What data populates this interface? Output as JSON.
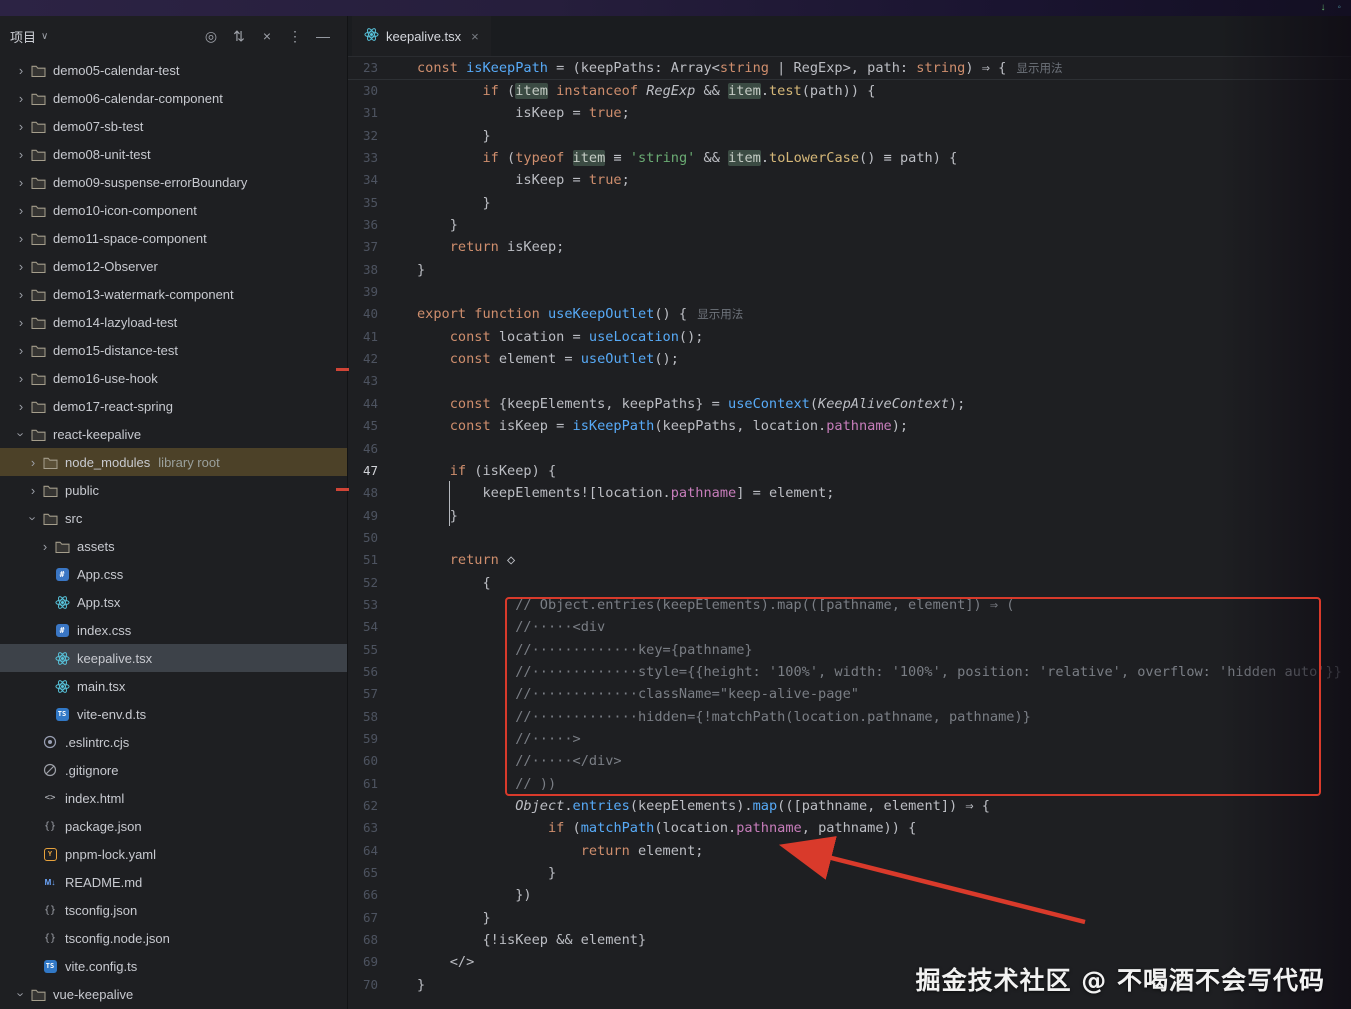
{
  "titlebar": {
    "right_icons": [
      "update-arrow-icon",
      "status-dot-icon"
    ]
  },
  "sidebar": {
    "toolbar": {
      "title": "项目",
      "caret": "∨",
      "icons": [
        "locate",
        "expand-all",
        "collapse-all",
        "more-options",
        "hide-panel"
      ]
    },
    "tree": [
      {
        "label": "demo05-calendar-test",
        "level": 0,
        "icon": "folder",
        "chev": "r"
      },
      {
        "label": "demo06-calendar-component",
        "level": 0,
        "icon": "folder",
        "chev": "r"
      },
      {
        "label": "demo07-sb-test",
        "level": 0,
        "icon": "folder",
        "chev": "r"
      },
      {
        "label": "demo08-unit-test",
        "level": 0,
        "icon": "folder",
        "chev": "r"
      },
      {
        "label": "demo09-suspense-errorBoundary",
        "level": 0,
        "icon": "folder",
        "chev": "r"
      },
      {
        "label": "demo10-icon-component",
        "level": 0,
        "icon": "folder",
        "chev": "r"
      },
      {
        "label": "demo11-space-component",
        "level": 0,
        "icon": "folder",
        "chev": "r"
      },
      {
        "label": "demo12-Observer",
        "level": 0,
        "icon": "folder",
        "chev": "r"
      },
      {
        "label": "demo13-watermark-component",
        "level": 0,
        "icon": "folder",
        "chev": "r"
      },
      {
        "label": "demo14-lazyload-test",
        "level": 0,
        "icon": "folder",
        "chev": "r"
      },
      {
        "label": "demo15-distance-test",
        "level": 0,
        "icon": "folder",
        "chev": "r"
      },
      {
        "label": "demo16-use-hook",
        "level": 0,
        "icon": "folder",
        "chev": "r"
      },
      {
        "label": "demo17-react-spring",
        "level": 0,
        "icon": "folder",
        "chev": "r"
      },
      {
        "label": "react-keepalive",
        "level": 0,
        "icon": "folder",
        "chev": "d"
      },
      {
        "label": "node_modules",
        "level": 1,
        "icon": "folder",
        "chev": "r",
        "badge": "library root",
        "hl": "lib"
      },
      {
        "label": "public",
        "level": 1,
        "icon": "folder",
        "chev": "r"
      },
      {
        "label": "src",
        "level": 1,
        "icon": "folder",
        "chev": "d"
      },
      {
        "label": "assets",
        "level": 2,
        "icon": "folder",
        "chev": "r"
      },
      {
        "label": "App.css",
        "level": 2,
        "icon": "css"
      },
      {
        "label": "App.tsx",
        "level": 2,
        "icon": "react"
      },
      {
        "label": "index.css",
        "level": 2,
        "icon": "css"
      },
      {
        "label": "keepalive.tsx",
        "level": 2,
        "icon": "react",
        "hl": "sel"
      },
      {
        "label": "main.tsx",
        "level": 2,
        "icon": "react"
      },
      {
        "label": "vite-env.d.ts",
        "level": 2,
        "icon": "ts"
      },
      {
        "label": ".eslintrc.cjs",
        "level": 1,
        "icon": "eslint"
      },
      {
        "label": ".gitignore",
        "level": 1,
        "icon": "ignore"
      },
      {
        "label": "index.html",
        "level": 1,
        "icon": "html"
      },
      {
        "label": "package.json",
        "level": 1,
        "icon": "json"
      },
      {
        "label": "pnpm-lock.yaml",
        "level": 1,
        "icon": "pnpm"
      },
      {
        "label": "README.md",
        "level": 1,
        "icon": "md"
      },
      {
        "label": "tsconfig.json",
        "level": 1,
        "icon": "json"
      },
      {
        "label": "tsconfig.node.json",
        "level": 1,
        "icon": "json"
      },
      {
        "label": "vite.config.ts",
        "level": 1,
        "icon": "ts"
      },
      {
        "label": "vue-keepalive",
        "level": 0,
        "icon": "folder",
        "chev": "d"
      }
    ]
  },
  "editor": {
    "tab": {
      "label": "keepalive.tsx",
      "close": "×"
    },
    "sticky": {
      "n": "23",
      "s": [
        [
          "const ",
          "k"
        ],
        [
          "isKeepPath",
          "f"
        ],
        [
          " = (keepPaths: Array<",
          "d"
        ],
        [
          "string",
          "k"
        ],
        [
          " | RegExp>, path: ",
          "d"
        ],
        [
          "string",
          "k"
        ],
        [
          ") ⇒ { ",
          "d"
        ],
        [
          "显示用法",
          "h"
        ]
      ]
    },
    "lines": [
      {
        "n": "30",
        "s": [
          [
            "        ",
            "d"
          ],
          [
            "if",
            "k"
          ],
          [
            " (",
            "d"
          ],
          [
            "item",
            "w"
          ],
          [
            " ",
            "d"
          ],
          [
            "instanceof",
            "k"
          ],
          [
            " ",
            "d"
          ],
          [
            "RegExp",
            "i"
          ],
          [
            " && ",
            "d"
          ],
          [
            "item",
            "w"
          ],
          [
            ".",
            "d"
          ],
          [
            "test",
            "m"
          ],
          [
            "(path)) {",
            "d"
          ]
        ]
      },
      {
        "n": "31",
        "s": [
          [
            "            isKeep = ",
            "d"
          ],
          [
            "true",
            "k"
          ],
          [
            ";",
            "d"
          ]
        ]
      },
      {
        "n": "32",
        "s": [
          [
            "        }",
            "d"
          ]
        ]
      },
      {
        "n": "33",
        "s": [
          [
            "        ",
            "d"
          ],
          [
            "if",
            "k"
          ],
          [
            " (",
            "d"
          ],
          [
            "typeof",
            "k"
          ],
          [
            " ",
            "d"
          ],
          [
            "item",
            "w"
          ],
          [
            " ≡ ",
            "d"
          ],
          [
            "'string'",
            "s"
          ],
          [
            " && ",
            "d"
          ],
          [
            "item",
            "w"
          ],
          [
            ".",
            "d"
          ],
          [
            "toLowerCase",
            "m"
          ],
          [
            "() ≡ path) {",
            "d"
          ]
        ]
      },
      {
        "n": "34",
        "s": [
          [
            "            isKeep = ",
            "d"
          ],
          [
            "true",
            "k"
          ],
          [
            ";",
            "d"
          ]
        ]
      },
      {
        "n": "35",
        "s": [
          [
            "        }",
            "d"
          ]
        ]
      },
      {
        "n": "36",
        "s": [
          [
            "    }",
            "d"
          ]
        ]
      },
      {
        "n": "37",
        "s": [
          [
            "    ",
            "d"
          ],
          [
            "return",
            "k"
          ],
          [
            " isKeep;",
            "d"
          ]
        ]
      },
      {
        "n": "38",
        "s": [
          [
            "}",
            "d"
          ]
        ]
      },
      {
        "n": "39",
        "s": []
      },
      {
        "n": "40",
        "s": [
          [
            "export",
            "k"
          ],
          [
            " ",
            "d"
          ],
          [
            "function",
            "k"
          ],
          [
            " ",
            "d"
          ],
          [
            "useKeepOutlet",
            "f"
          ],
          [
            "() { ",
            "d"
          ],
          [
            "显示用法",
            "h"
          ]
        ]
      },
      {
        "n": "41",
        "s": [
          [
            "    ",
            "d"
          ],
          [
            "const",
            "k"
          ],
          [
            " location = ",
            "d"
          ],
          [
            "useLocation",
            "f"
          ],
          [
            "();",
            "d"
          ]
        ]
      },
      {
        "n": "42",
        "s": [
          [
            "    ",
            "d"
          ],
          [
            "const",
            "k"
          ],
          [
            " element = ",
            "d"
          ],
          [
            "useOutlet",
            "f"
          ],
          [
            "();",
            "d"
          ]
        ]
      },
      {
        "n": "43",
        "s": []
      },
      {
        "n": "44",
        "s": [
          [
            "    ",
            "d"
          ],
          [
            "const",
            "k"
          ],
          [
            " {keepElements, keepPaths} = ",
            "d"
          ],
          [
            "useContext",
            "f"
          ],
          [
            "(",
            "d"
          ],
          [
            "KeepAliveContext",
            "i"
          ],
          [
            ");",
            "d"
          ]
        ]
      },
      {
        "n": "45",
        "s": [
          [
            "    ",
            "d"
          ],
          [
            "const",
            "k"
          ],
          [
            " isKeep = ",
            "d"
          ],
          [
            "isKeepPath",
            "f"
          ],
          [
            "(keepPaths, location.",
            "d"
          ],
          [
            "pathname",
            "p"
          ],
          [
            ");",
            "d"
          ]
        ]
      },
      {
        "n": "46",
        "s": []
      },
      {
        "n": "47",
        "cur": true,
        "s": [
          [
            "    ",
            "d"
          ],
          [
            "if",
            "k"
          ],
          [
            " (isKeep) {",
            "d"
          ]
        ]
      },
      {
        "n": "48",
        "s": [
          [
            "        keepElements![location.",
            "d"
          ],
          [
            "pathname",
            "p"
          ],
          [
            "] = element;",
            "d"
          ]
        ]
      },
      {
        "n": "49",
        "s": [
          [
            "    }",
            "d"
          ]
        ]
      },
      {
        "n": "50",
        "s": []
      },
      {
        "n": "51",
        "s": [
          [
            "    ",
            "d"
          ],
          [
            "return",
            "k"
          ],
          [
            " ◇",
            "d"
          ]
        ]
      },
      {
        "n": "52",
        "s": [
          [
            "        {",
            "d"
          ]
        ]
      },
      {
        "n": "53",
        "s": [
          [
            "            ",
            "d"
          ],
          [
            "// Object.entries(keepElements).map(([pathname, element]) ⇒ (",
            "c"
          ]
        ]
      },
      {
        "n": "54",
        "s": [
          [
            "            ",
            "d"
          ],
          [
            "//·····<div",
            "c"
          ]
        ]
      },
      {
        "n": "55",
        "s": [
          [
            "            ",
            "d"
          ],
          [
            "//·············key={pathname}",
            "c"
          ]
        ]
      },
      {
        "n": "56",
        "s": [
          [
            "            ",
            "d"
          ],
          [
            "//·············style={{height: '100%', width: '100%', position: 'relative', overflow: 'hidden auto'}}",
            "c"
          ]
        ]
      },
      {
        "n": "57",
        "s": [
          [
            "            ",
            "d"
          ],
          [
            "//·············className=\"keep-alive-page\"",
            "c"
          ]
        ]
      },
      {
        "n": "58",
        "s": [
          [
            "            ",
            "d"
          ],
          [
            "//·············hidden={!matchPath(location.pathname, pathname)}",
            "c"
          ]
        ]
      },
      {
        "n": "59",
        "s": [
          [
            "            ",
            "d"
          ],
          [
            "//·····>",
            "c"
          ]
        ]
      },
      {
        "n": "60",
        "s": [
          [
            "            ",
            "d"
          ],
          [
            "//·····</div>",
            "c"
          ]
        ]
      },
      {
        "n": "61",
        "s": [
          [
            "            ",
            "d"
          ],
          [
            "// ))",
            "c"
          ]
        ]
      },
      {
        "n": "62",
        "s": [
          [
            "            ",
            "d"
          ],
          [
            "Object",
            "i"
          ],
          [
            ".",
            "d"
          ],
          [
            "entries",
            "f"
          ],
          [
            "(keepElements).",
            "d"
          ],
          [
            "map",
            "f"
          ],
          [
            "(([pathname, element]) ⇒ {",
            "d"
          ]
        ]
      },
      {
        "n": "63",
        "s": [
          [
            "                ",
            "d"
          ],
          [
            "if",
            "k"
          ],
          [
            " (",
            "d"
          ],
          [
            "matchPath",
            "f"
          ],
          [
            "(location.",
            "d"
          ],
          [
            "pathname",
            "p"
          ],
          [
            ", pathname)) {",
            "d"
          ]
        ]
      },
      {
        "n": "64",
        "s": [
          [
            "                    ",
            "d"
          ],
          [
            "return",
            "k"
          ],
          [
            " element;",
            "d"
          ]
        ]
      },
      {
        "n": "65",
        "s": [
          [
            "                }",
            "d"
          ]
        ]
      },
      {
        "n": "66",
        "s": [
          [
            "            })",
            "d"
          ]
        ]
      },
      {
        "n": "67",
        "s": [
          [
            "        }",
            "d"
          ]
        ]
      },
      {
        "n": "68",
        "s": [
          [
            "        {!isKeep && element}",
            "d"
          ]
        ]
      },
      {
        "n": "69",
        "s": [
          [
            "    </>",
            "d"
          ]
        ]
      },
      {
        "n": "70",
        "s": [
          [
            "}",
            "d"
          ]
        ]
      }
    ]
  },
  "annotations": {
    "watermark": "掘金技术社区 @ 不喝酒不会写代码"
  }
}
